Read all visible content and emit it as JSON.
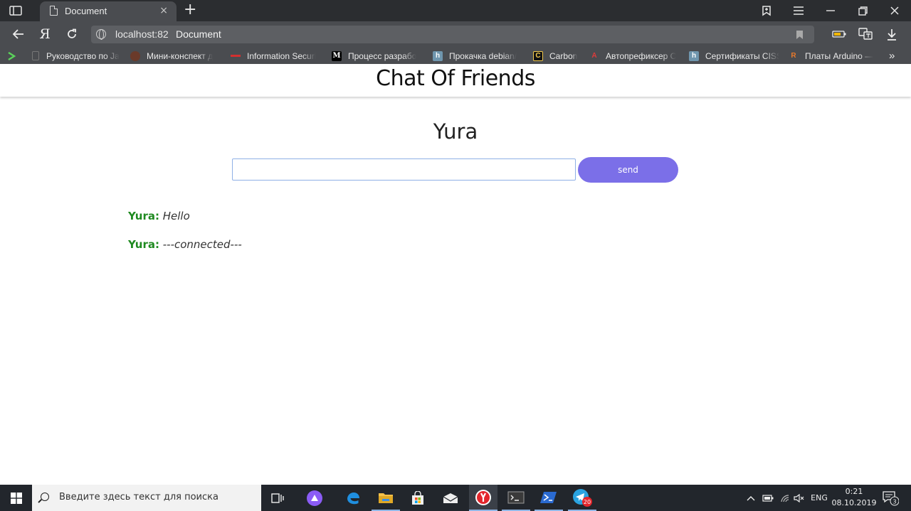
{
  "browser": {
    "tab_title": "Document",
    "tab_close": "×",
    "new_tab": "+",
    "url": "localhost:82",
    "page_title": "Document",
    "yandex_logo": "Я",
    "bookmarks": [
      {
        "label": "Руководство по Ja",
        "icon": "page-icon"
      },
      {
        "label": "Мини-конспект д",
        "icon": "avatar-icon"
      },
      {
        "label": "Information Securi",
        "icon": "red-dash-icon"
      },
      {
        "label": "Процесс разрабо",
        "icon": "m-logo-icon",
        "glyph": "M"
      },
      {
        "label": "Прокачка debian/",
        "icon": "h-logo-icon",
        "glyph": "h"
      },
      {
        "label": "Carbon",
        "icon": "carbon-logo-icon",
        "glyph": "C"
      },
      {
        "label": "Автопрефиксер C",
        "icon": "a-logo-icon",
        "glyph": "A"
      },
      {
        "label": "Сертификаты CISS",
        "icon": "h-logo-icon",
        "glyph": "h"
      },
      {
        "label": "Платы Arduino —",
        "icon": "r-logo-icon",
        "glyph": "R"
      }
    ],
    "more_bookmarks": "»"
  },
  "app": {
    "header_title": "Chat Of Friends",
    "username": "Yura",
    "input_value": "",
    "send_label": "send",
    "messages": [
      {
        "author": "Yura:",
        "text": "Hello"
      },
      {
        "author": "Yura:",
        "text": "---connected---"
      }
    ]
  },
  "taskbar": {
    "search_placeholder": "Введите здесь текст для поиска",
    "language": "ENG",
    "time": "0:21",
    "date": "08.10.2019",
    "telegram_badge": "20",
    "notifications_count": "3"
  },
  "colors": {
    "send_button": "#7b6fe8",
    "author": "#1f8a20",
    "input_border": "#8fb0e6"
  }
}
